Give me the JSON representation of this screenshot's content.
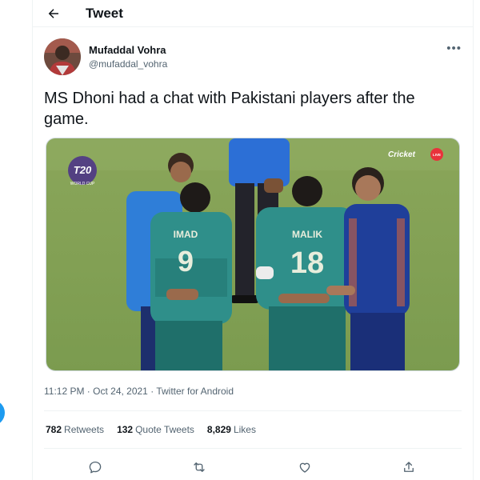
{
  "header": {
    "title": "Tweet"
  },
  "tweet": {
    "author_name": "Mufaddal Vohra",
    "author_handle": "@mufaddal_vohra",
    "text": "MS Dhoni had a chat with Pakistani players after the game.",
    "timestamp": "11:12 PM · Oct 24, 2021",
    "separator": " · ",
    "source": "Twitter for Android"
  },
  "media": {
    "logo_text": "T20",
    "logo_subtext": "WORLD CUP",
    "broadcaster": "Cricket",
    "live_badge": "LIVE",
    "player_left_name": "IMAD",
    "player_left_number": "9",
    "player_right_name": "MALIK",
    "player_right_number": "18"
  },
  "stats": {
    "retweets_count": "782",
    "retweets_label": "Retweets",
    "quotes_count": "132",
    "quotes_label": "Quote Tweets",
    "likes_count": "8,829",
    "likes_label": "Likes"
  },
  "icons": {
    "back": "arrow-left-icon",
    "more": "more-horizontal-icon",
    "reply": "reply-icon",
    "retweet": "retweet-icon",
    "like": "heart-icon",
    "share": "share-icon"
  },
  "colors": {
    "accent": "#1d9bf0",
    "text": "#0f1419",
    "muted": "#536471"
  }
}
